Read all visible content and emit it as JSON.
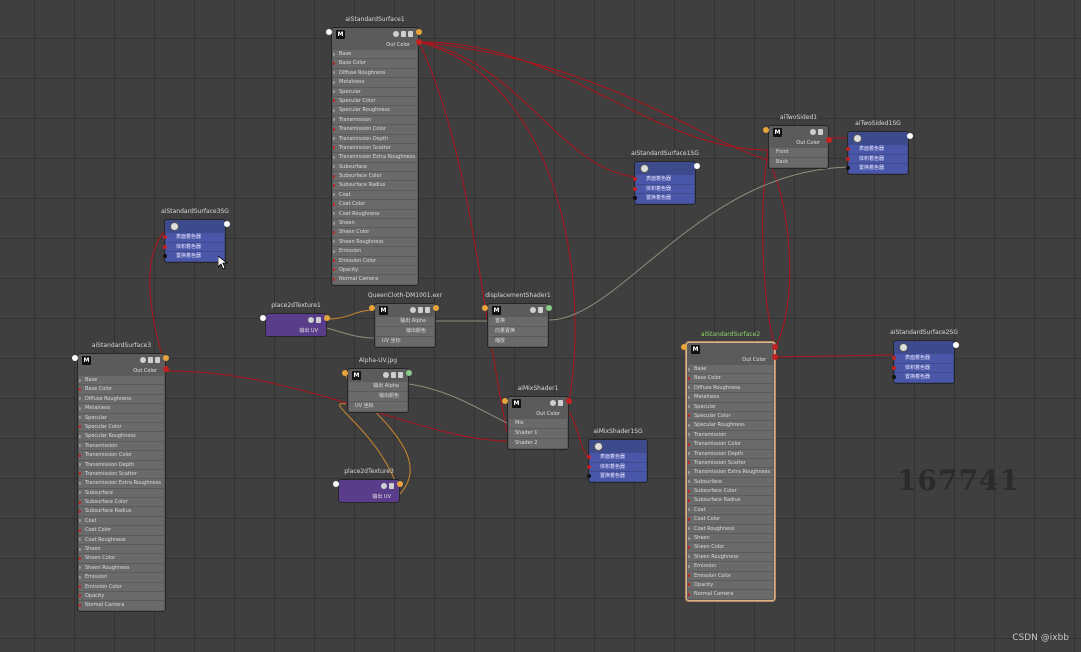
{
  "colors": {
    "grid_bg": "#3f3f3f",
    "wire_red": "#b0141e",
    "wire_grey": "#8e8e7c",
    "wire_orange": "#c9862e",
    "shading_group": "#3d4a8c",
    "place2d": "#5a3d8a",
    "selected_title": "#8cd86c"
  },
  "standard_attrs": [
    "Base",
    "Base Color",
    "Diffuse Roughness",
    "Metalness",
    "Specular",
    "Specular Color",
    "Specular Roughness",
    "Transmission",
    "Transmission Color",
    "Transmission Depth",
    "Transmission Scatter",
    "Transmission Extra Roughness",
    "Subsurface",
    "Subsurface Color",
    "Subsurface Radius",
    "Coat",
    "Coat Color",
    "Coat Roughness",
    "Sheen",
    "Sheen Color",
    "Sheen Roughness",
    "Emission",
    "Emission Color",
    "Opacity",
    "Normal Camera"
  ],
  "sg_rows": [
    "表面着色器",
    "体积着色器",
    "置换着色器"
  ],
  "nodes": {
    "ss1": {
      "title": "aiStandardSurface1",
      "out": "Out Color",
      "icon": "M"
    },
    "ss2": {
      "title": "aiStandardSurface2",
      "out": "Out Color",
      "icon": "M"
    },
    "ss3": {
      "title": "aiStandardSurface3",
      "out": "Out Color",
      "icon": "M"
    },
    "sg3": {
      "title": "aiStandardSurface3SG"
    },
    "sg1": {
      "title": "aiStandardSurface1SG"
    },
    "sg2": {
      "title": "aiStandardSurface2SG"
    },
    "twosided": {
      "title": "aiTwoSided1",
      "out": "Out Color",
      "front": "Front",
      "back": "Back",
      "icon": "M"
    },
    "twosg": {
      "title": "aiTwoSided1SG"
    },
    "p2d1": {
      "title": "place2dTexture1",
      "out": "输出 UV"
    },
    "p2d3": {
      "title": "place2dTexture3",
      "out": "输出 UV"
    },
    "queen": {
      "title": "QueenCloth-DM1001.exr",
      "out1": "输出 Alpha",
      "out2": "输出颜色",
      "in1": "UV 坐标",
      "icon": "M"
    },
    "alpha": {
      "title": "Alpha-UV.jpg",
      "out1": "输出 Alpha",
      "out2": "输出颜色",
      "in1": "UV 坐标",
      "icon": "M"
    },
    "disp": {
      "title": "displacementShader1",
      "r1": "置换",
      "r2": "向量置换",
      "r3": "缩放",
      "icon": "M"
    },
    "mix": {
      "title": "aiMixShader1",
      "out": "Out Color",
      "r1": "Mix",
      "r2": "Shader 1",
      "r3": "Shader 2",
      "icon": "M"
    },
    "mixsg": {
      "title": "aiMixShader1SG"
    }
  },
  "watermark": "167741",
  "credit": "CSDN @ixbb"
}
